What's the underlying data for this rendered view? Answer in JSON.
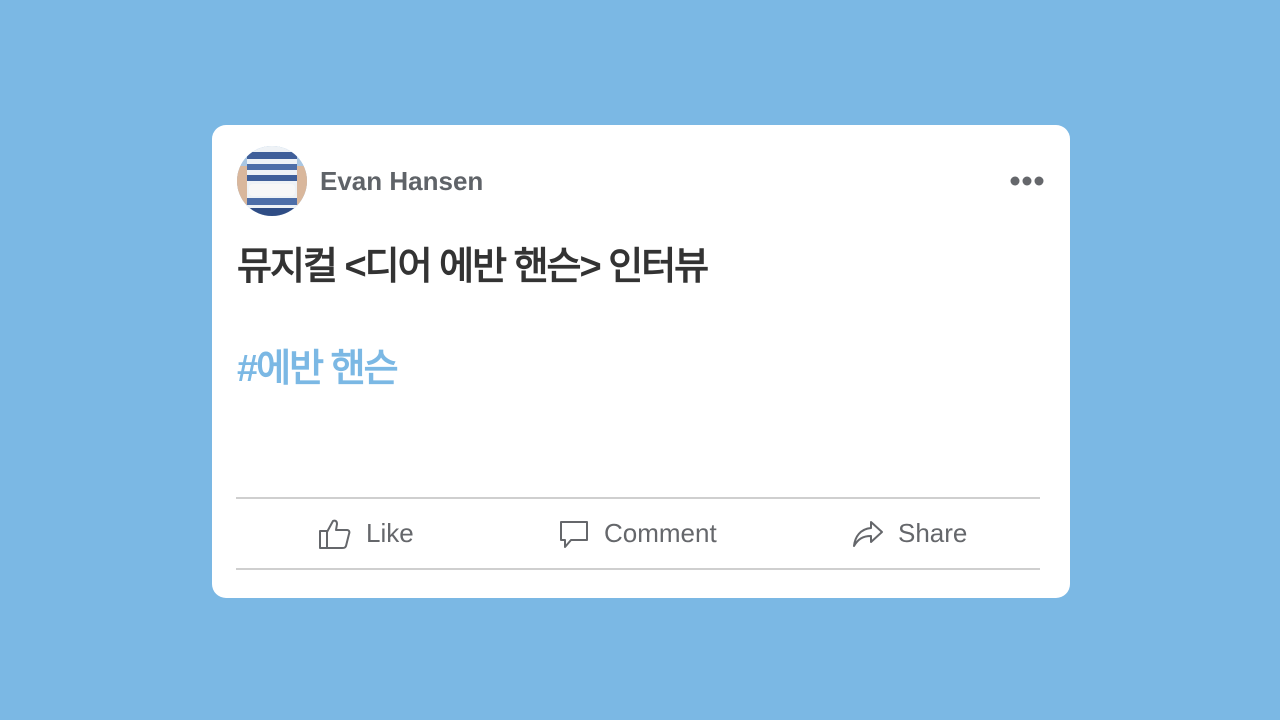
{
  "post": {
    "author": "Evan Hansen",
    "title": "뮤지컬 <디어 에반 핸슨> 인터뷰",
    "hashtag": "#에반 핸슨"
  },
  "actions": {
    "like": "Like",
    "comment": "Comment",
    "share": "Share"
  },
  "icons": {
    "more": "more-options-icon",
    "like": "thumbs-up-icon",
    "comment": "speech-bubble-icon",
    "share": "share-arrow-icon"
  },
  "colors": {
    "background": "#7bb8e4",
    "card": "#ffffff",
    "hashtag": "#7bb8e4",
    "title": "#333333",
    "author": "#5f6368",
    "actions": "#65676b"
  }
}
